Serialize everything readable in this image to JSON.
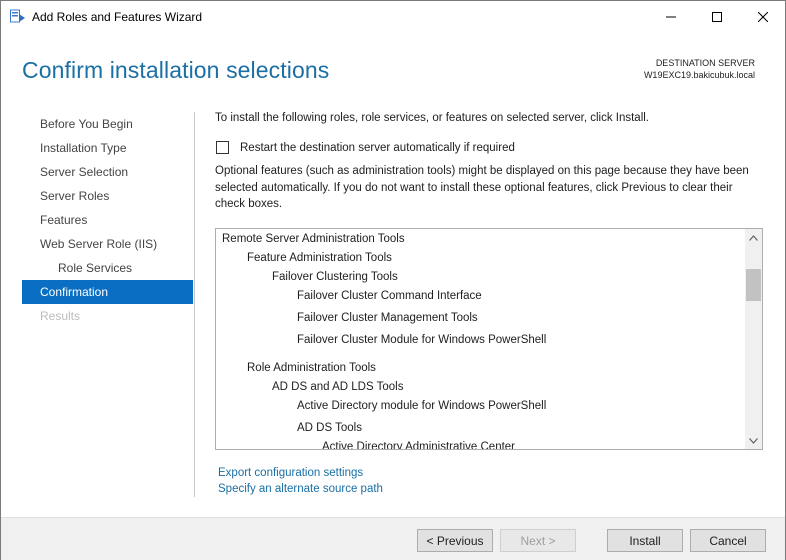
{
  "window": {
    "title": "Add Roles and Features Wizard"
  },
  "header": {
    "title": "Confirm installation selections",
    "destination_label": "DESTINATION SERVER",
    "destination_server": "W19EXC19.bakicubuk.local"
  },
  "nav": {
    "items": [
      {
        "label": "Before You Begin",
        "state": "normal"
      },
      {
        "label": "Installation Type",
        "state": "normal"
      },
      {
        "label": "Server Selection",
        "state": "normal"
      },
      {
        "label": "Server Roles",
        "state": "normal"
      },
      {
        "label": "Features",
        "state": "normal"
      },
      {
        "label": "Web Server Role (IIS)",
        "state": "normal"
      },
      {
        "label": "Role Services",
        "state": "sub"
      },
      {
        "label": "Confirmation",
        "state": "active"
      },
      {
        "label": "Results",
        "state": "disabled"
      }
    ]
  },
  "content": {
    "intro": "To install the following roles, role services, or features on selected server, click Install.",
    "restart_label": "Restart the destination server automatically if required",
    "restart_checked": false,
    "optional_note": "Optional features (such as administration tools) might be displayed on this page because they have been selected automatically. If you do not want to install these optional features, click Previous to clear their check boxes."
  },
  "features": {
    "items": [
      {
        "label": "Remote Server Administration Tools",
        "level": 0
      },
      {
        "label": "Feature Administration Tools",
        "level": 1
      },
      {
        "label": "Failover Clustering Tools",
        "level": 2
      },
      {
        "label": "Failover Cluster Command Interface",
        "level": 3
      },
      {
        "label": "Failover Cluster Management Tools",
        "level": 3
      },
      {
        "label": "Failover Cluster Module for Windows PowerShell",
        "level": 3
      },
      {
        "label": "Role Administration Tools",
        "level": 1
      },
      {
        "label": "AD DS and AD LDS Tools",
        "level": 2
      },
      {
        "label": "Active Directory module for Windows PowerShell",
        "level": 3
      },
      {
        "label": "AD DS Tools",
        "level": 3
      },
      {
        "label": "Active Directory Administrative Center",
        "level": 4
      }
    ]
  },
  "links": {
    "export": "Export configuration settings",
    "alternate_source": "Specify an alternate source path"
  },
  "buttons": {
    "previous": "< Previous",
    "next": "Next >",
    "install": "Install",
    "cancel": "Cancel"
  },
  "colors": {
    "accent": "#1a6fa5",
    "selection": "#0a6fc2"
  }
}
